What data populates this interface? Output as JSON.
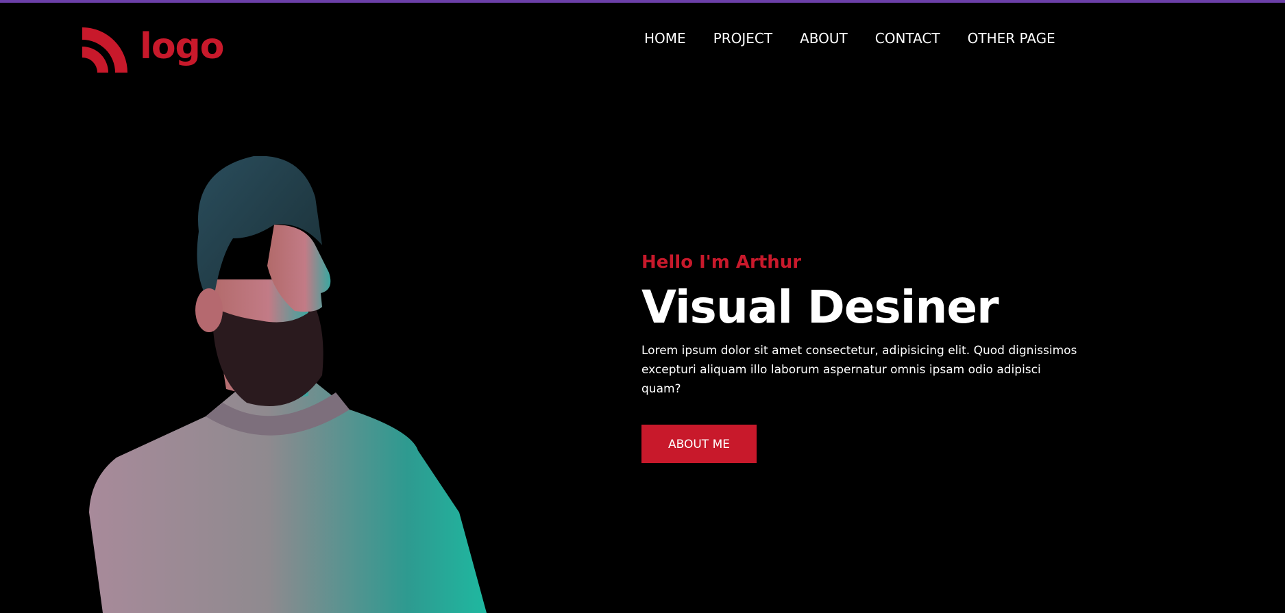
{
  "brand": {
    "logo_text": "logo",
    "accent_color": "#c8192b",
    "icon": "logo-arcs-icon"
  },
  "nav": {
    "items": [
      {
        "label": "HOME"
      },
      {
        "label": "PROJECT"
      },
      {
        "label": "ABOUT"
      },
      {
        "label": "CONTACT"
      },
      {
        "label": "OTHER PAGE"
      }
    ]
  },
  "hero": {
    "greeting": "Hello I'm Arthur",
    "title": "Visual Desiner",
    "description": "Lorem ipsum dolor sit amet consectetur, adipisicing elit. Quod dignissimos excepturi aliquam illo laborum aspernatur omnis ipsam odio adipisci quam?",
    "button_label": "ABOUT ME"
  },
  "colors": {
    "background": "#000000",
    "top_strip": "#6b3fa8",
    "text": "#ffffff"
  }
}
